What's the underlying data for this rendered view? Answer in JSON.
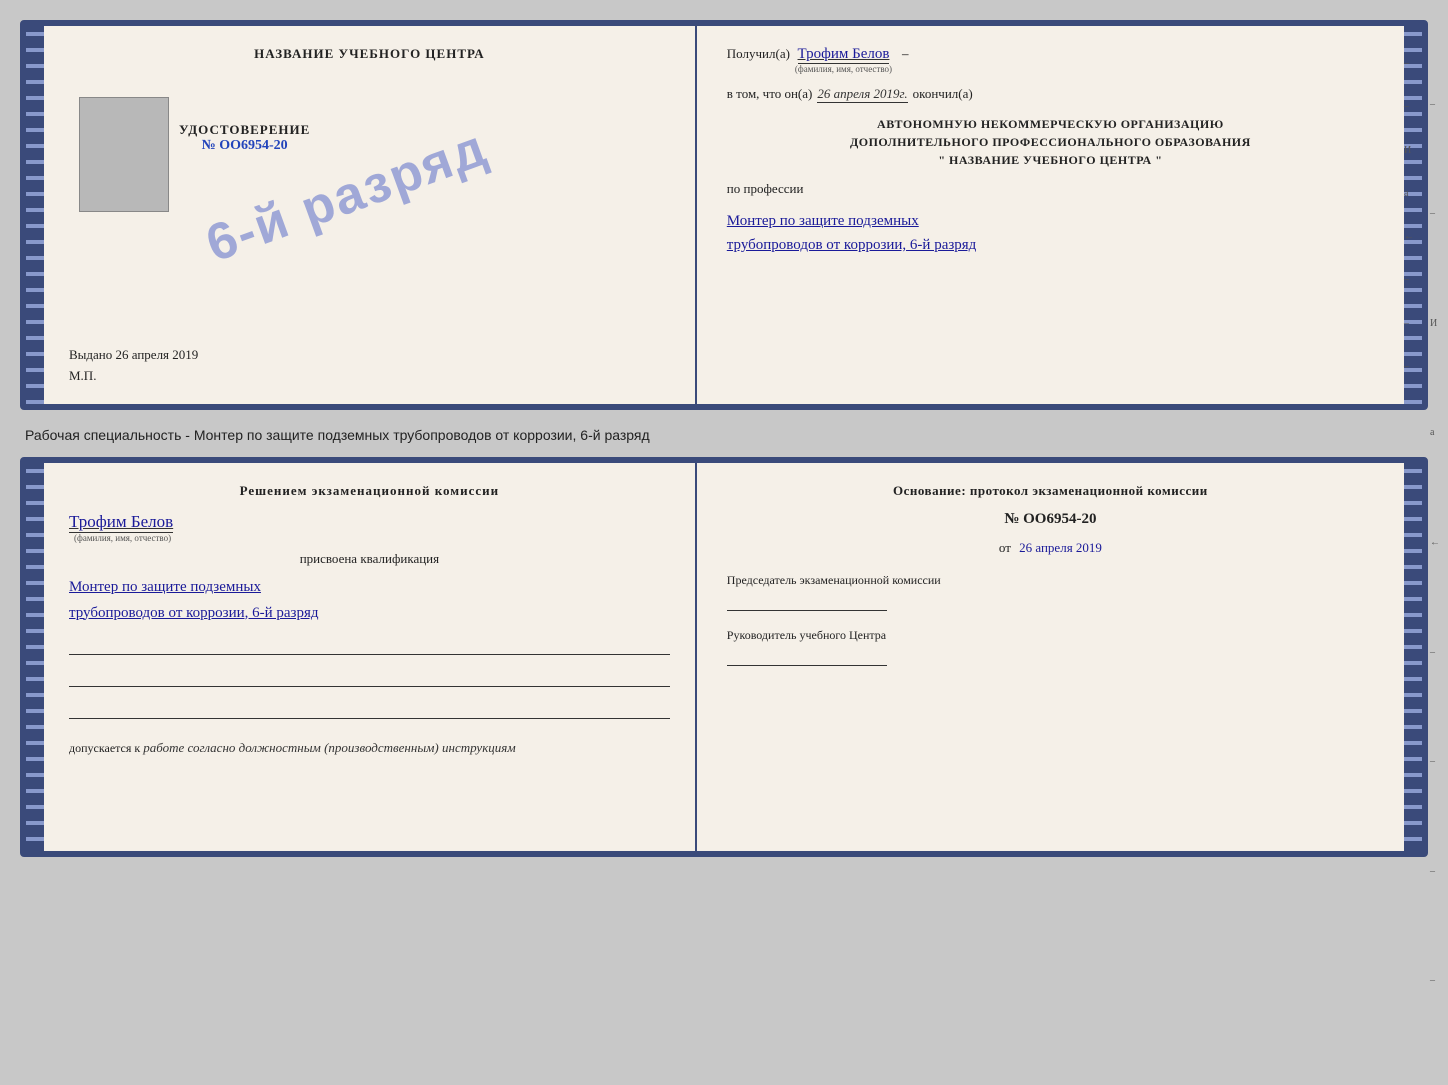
{
  "doc1": {
    "left": {
      "title": "НАЗВАНИЕ УЧЕБНОГО ЦЕНТРА",
      "stamp": "6-й разряд",
      "udost_title": "УДОСТОВЕРЕНИЕ",
      "udost_num": "№ OO6954-20",
      "vydano": "Выдано 26 апреля 2019",
      "mp": "М.П."
    },
    "right": {
      "poluchil_label": "Получил(а)",
      "poluchil_name": "Трофим Белов",
      "poluchil_sub": "(фамилия, имя, отчество)",
      "vtom_prefix": "в том, что он(а)",
      "vtom_date": "26 апреля 2019г.",
      "vtom_suffix": "окончил(а)",
      "org_line1": "АВТОНОМНУЮ НЕКОММЕРЧЕСКУЮ ОРГАНИЗАЦИЮ",
      "org_line2": "ДОПОЛНИТЕЛЬНОГО ПРОФЕССИОНАЛЬНОГО ОБРАЗОВАНИЯ",
      "org_line3": "\"    НАЗВАНИЕ УЧЕБНОГО ЦЕНТРА    \"",
      "po_professii": "по профессии",
      "profession_line1": "Монтер по защите подземных",
      "profession_line2": "трубопроводов от коррозии, 6-й разряд"
    }
  },
  "between": {
    "text": "Рабочая специальность - Монтер по защите подземных трубопроводов от коррозии, 6-й разряд"
  },
  "doc2": {
    "left": {
      "resheniem": "Решением экзаменационной комиссии",
      "name": "Трофим Белов",
      "name_sub": "(фамилия, имя, отчество)",
      "prisvoena": "присвоена квалификация",
      "kvalif_line1": "Монтер по защите подземных",
      "kvalif_line2": "трубопроводов от коррозии, 6-й разряд",
      "dopuskaetsya_prefix": "допускается к",
      "dopusk_text": "работе согласно должностным (производственным) инструкциям"
    },
    "right": {
      "osnovanie": "Основание: протокол экзаменационной комиссии",
      "protocol_num": "№  OO6954-20",
      "ot_prefix": "от",
      "ot_date": "26 апреля 2019",
      "predsedatel_label": "Председатель экзаменационной комиссии",
      "rukovoditel_label": "Руководитель учебного Центра"
    }
  }
}
